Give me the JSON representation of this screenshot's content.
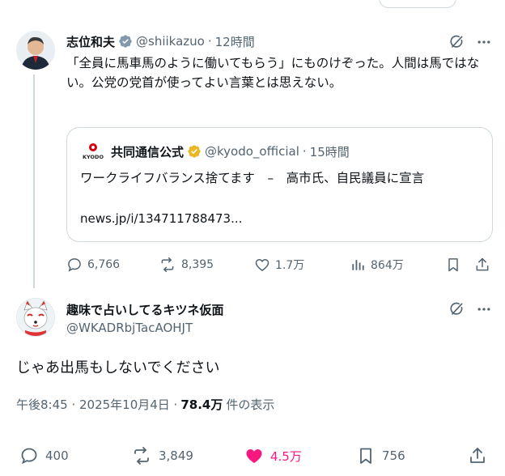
{
  "original_post": {
    "author_name": "志位和夫",
    "handle": "@shiikazuo",
    "separator": "·",
    "time": "12時間",
    "text": "「全員に馬車馬のように働いてもらう」にものけぞった。人間は馬ではない。公党の党首が使ってよい言葉とは思えない。",
    "quote": {
      "logo_text": "KYODO",
      "author_name": "共同通信公式",
      "handle": "@kyodo_official",
      "separator": "·",
      "time": "15時間",
      "text": "ワークライフバランス捨てます　–　高市氏、自民議員に宣言",
      "link": "news.jp/i/134711788473..."
    },
    "stats": {
      "replies": "6,766",
      "reposts": "8,395",
      "likes": "1.7万",
      "views": "864万"
    }
  },
  "reply_post": {
    "author_name": "趣味で占いしてるキツネ仮面",
    "handle": "@WKADRbjTacAOHJT",
    "text": "じゃあ出馬もしないでください",
    "timestamp": "午後8:45 · 2025年10月4日 ·",
    "views_count": "78.4万",
    "views_label": "件の表示",
    "stats": {
      "replies": "400",
      "reposts": "3,849",
      "likes": "4.5万",
      "bookmarks": "756"
    }
  },
  "colors": {
    "text_primary": "#0f1419",
    "text_secondary": "#536471",
    "border": "#cfd9de",
    "like_active": "#f91880",
    "verified_gold": "#e8b829",
    "kyodo_red": "#d7000f"
  },
  "icons": [
    "verified-badge-icon",
    "grok-icon",
    "more-icon",
    "reply-icon",
    "repost-icon",
    "like-icon",
    "views-icon",
    "bookmark-icon",
    "share-icon"
  ]
}
